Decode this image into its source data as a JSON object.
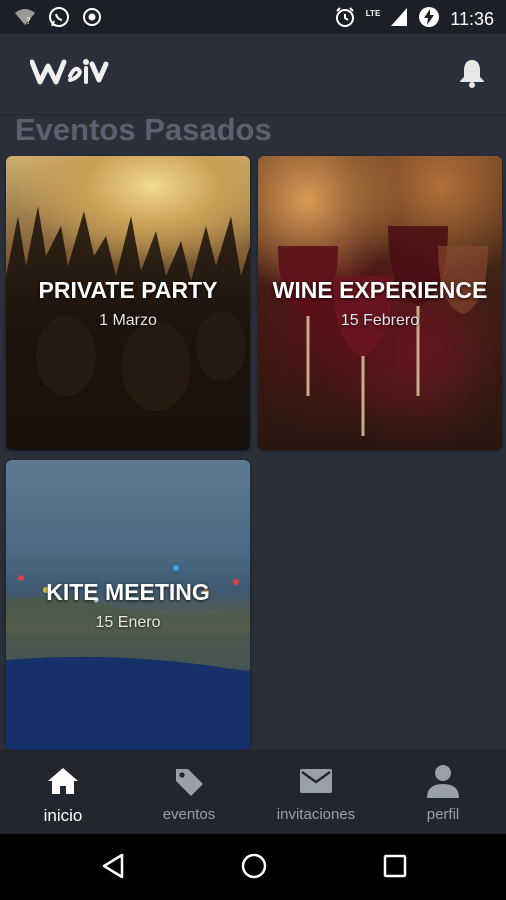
{
  "status_bar": {
    "time": "11:36",
    "network": "LTE",
    "icons": [
      "wifi-question-icon",
      "whatsapp-icon",
      "record-icon",
      "alarm-icon",
      "signal-icon",
      "battery-charging-icon"
    ]
  },
  "app_bar": {
    "logo_text": "Weiv",
    "notification_icon": "bell-icon"
  },
  "section": {
    "title": "Eventos Pasados"
  },
  "events": [
    {
      "title": "PRIVATE PARTY",
      "date": "1 Marzo"
    },
    {
      "title": "WINE EXPERIENCE",
      "date": "15 Febrero"
    },
    {
      "title": "KITE MEETING",
      "date": "15 Enero"
    }
  ],
  "bottom_nav": {
    "items": [
      {
        "label": "inicio",
        "icon": "home-icon",
        "active": true
      },
      {
        "label": "eventos",
        "icon": "tag-icon",
        "active": false
      },
      {
        "label": "invitaciones",
        "icon": "mail-icon",
        "active": false
      },
      {
        "label": "perfil",
        "icon": "person-icon",
        "active": false
      }
    ]
  },
  "system_nav": {
    "buttons": [
      "back-icon",
      "home-circle-icon",
      "recents-icon"
    ]
  },
  "colors": {
    "background": "#2a2f3a",
    "status_bar": "#1c1f26",
    "bottom_nav": "#23262d",
    "section_title": "#5b6170",
    "nav_inactive": "#9aa0a8",
    "nav_active": "#ffffff"
  }
}
